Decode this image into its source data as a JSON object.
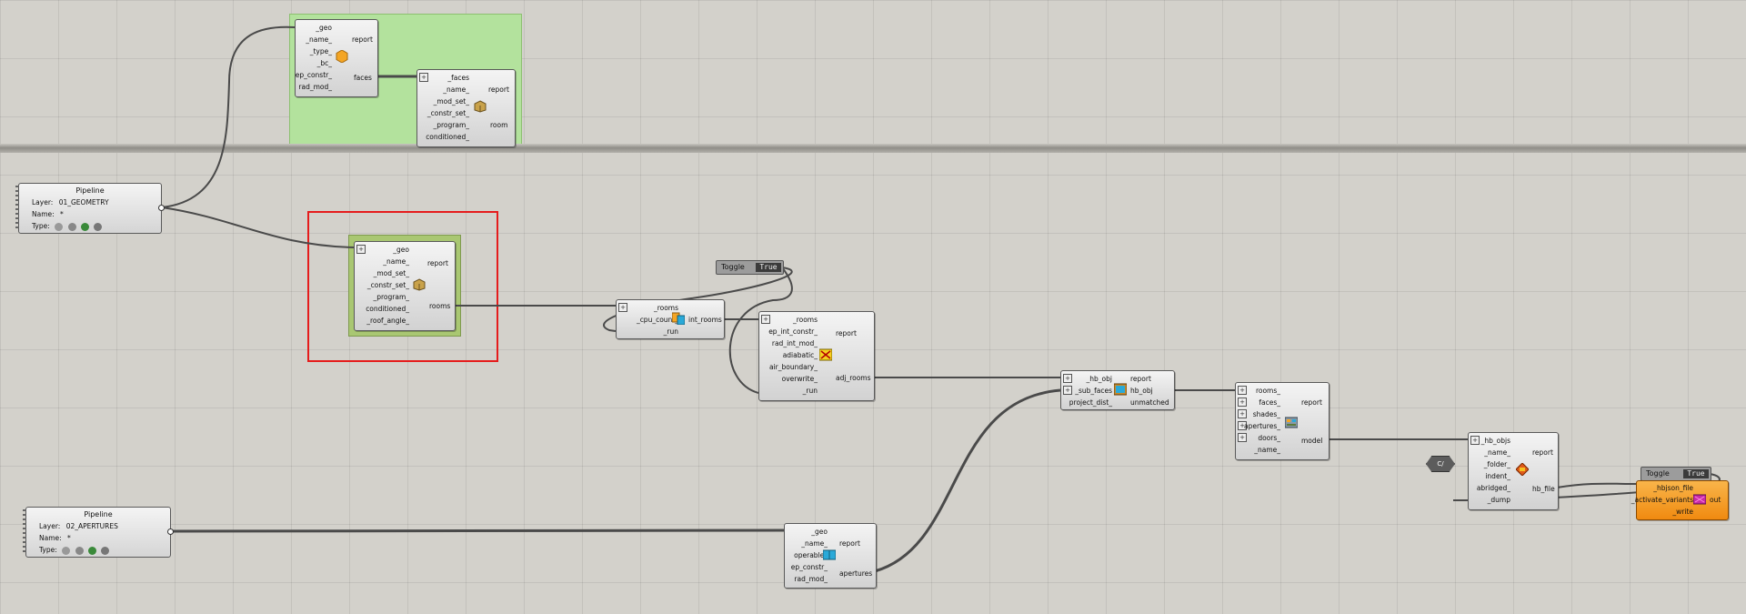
{
  "colors": {
    "canvas": "#d3d1cb",
    "group_green": "#b3e29d",
    "group_olive": "#a9c772",
    "highlight": "#e51c1c",
    "output_orange": "#f7a02c"
  },
  "pipeline_geometry": {
    "title": "Pipeline",
    "layer_label": "Layer:",
    "layer_value": "01_GEOMETRY",
    "name_label": "Name:",
    "name_value": "*",
    "type_label": "Type:"
  },
  "pipeline_apertures": {
    "title": "Pipeline",
    "layer_label": "Layer:",
    "layer_value": "02_APERTURES",
    "name_label": "Name:",
    "name_value": "*",
    "type_label": "Type:"
  },
  "face_comp": {
    "inputs": [
      "_geo",
      "_name_",
      "_type_",
      "_bc_",
      "ep_constr_",
      "rad_mod_"
    ],
    "outputs": [
      "report",
      "faces"
    ],
    "icon": "face-hexagon-icon"
  },
  "room_faces_comp": {
    "inputs": [
      "_faces",
      "_name_",
      "_mod_set_",
      "_constr_set_",
      "_program_",
      "conditioned_"
    ],
    "outputs": [
      "report",
      "room"
    ],
    "icon": "room-box-icon"
  },
  "room_solid_comp": {
    "inputs": [
      "_geo",
      "_name_",
      "_mod_set_",
      "_constr_set_",
      "_program_",
      "conditioned_",
      "_roof_angle_"
    ],
    "outputs": [
      "report",
      "rooms"
    ],
    "icon": "room-box-icon"
  },
  "intersect_comp": {
    "inputs": [
      "_rooms",
      "_cpu_count_",
      "_run"
    ],
    "outputs": [
      "int_rooms"
    ],
    "icon": "intersect-icon"
  },
  "adjacency_comp": {
    "inputs": [
      "_rooms",
      "ep_int_constr_",
      "rad_int_mod_",
      "adiabatic_",
      "air_boundary_",
      "overwrite_",
      "_run"
    ],
    "outputs": [
      "report",
      "adj_rooms"
    ],
    "icon": "adjacency-icon"
  },
  "add_subface_comp": {
    "inputs": [
      "_hb_obj",
      "_sub_faces",
      "project_dist_"
    ],
    "outputs": [
      "report",
      "hb_obj",
      "unmatched"
    ],
    "icon": "subface-icon"
  },
  "model_comp": {
    "inputs": [
      "rooms_",
      "faces_",
      "shades_",
      "apertures_",
      "doors_",
      "_name_"
    ],
    "outputs": [
      "report",
      "model"
    ],
    "icon": "model-icon"
  },
  "dump_comp": {
    "inputs": [
      "_hb_objs",
      "_name_",
      "_folder_",
      "indent_",
      "abridged_",
      "_dump"
    ],
    "outputs": [
      "report",
      "hb_file"
    ],
    "icon": "dump-icon"
  },
  "aperture_comp": {
    "inputs": [
      "_geo",
      "_name_",
      "operable_",
      "ep_constr_",
      "rad_mod_"
    ],
    "outputs": [
      "report",
      "apertures"
    ],
    "icon": "aperture-icon"
  },
  "writer_comp": {
    "inputs": [
      "_hbjson_file",
      "_activate_variants",
      "_write"
    ],
    "outputs": [
      "out"
    ],
    "icon": "writer-icon"
  },
  "toggle_1": {
    "name": "Toggle",
    "value": "True"
  },
  "toggle_2": {
    "name": "Toggle",
    "value": "True"
  },
  "cf_param": {
    "label": "C/"
  }
}
